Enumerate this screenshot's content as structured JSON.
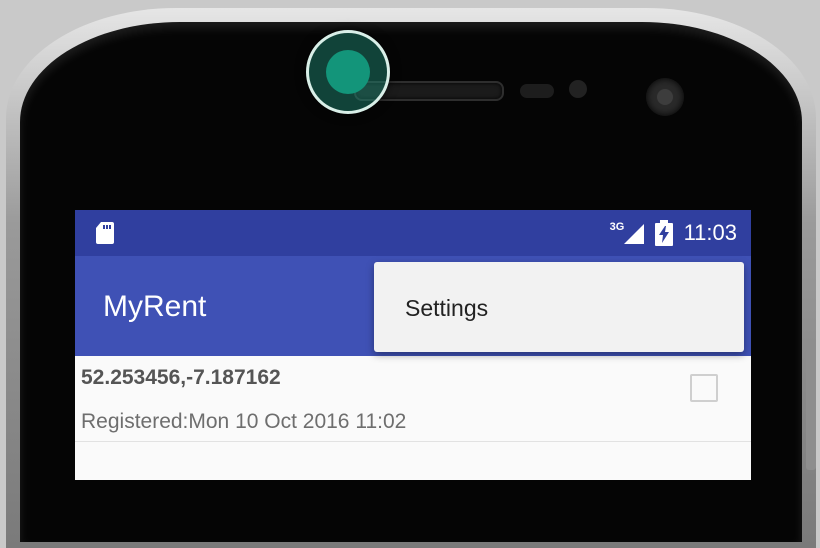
{
  "status_bar": {
    "time": "11:03",
    "network": "3G",
    "icons": [
      "sd-card-icon",
      "signal-icon",
      "battery-charging-icon"
    ]
  },
  "toolbar": {
    "title": "MyRent"
  },
  "overflow_menu": {
    "items": [
      {
        "label": "Settings"
      }
    ]
  },
  "residences": [
    {
      "geolocation": "52.253456,-7.187162",
      "date": "Registered:Mon 10 Oct 2016 11:02",
      "rented": false
    }
  ],
  "colors": {
    "status_bar": "#303f9f",
    "toolbar": "#3f51b5",
    "touch_indicator": "#13957a"
  }
}
